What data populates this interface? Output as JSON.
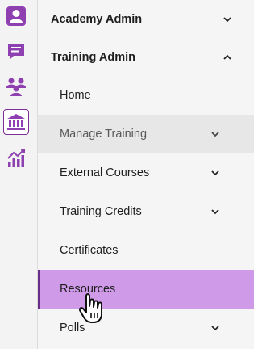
{
  "rail": {
    "icons": [
      "person-icon",
      "chat-icon",
      "group-icon",
      "academy-icon",
      "analytics-icon"
    ],
    "active_icon": "academy-icon",
    "accent_color": "#7a2f9a"
  },
  "menu": {
    "sections": [
      {
        "label": "Academy Admin",
        "expanded": false
      },
      {
        "label": "Training Admin",
        "expanded": true
      }
    ],
    "items": [
      {
        "label": "Home",
        "has_children": false
      },
      {
        "label": "Manage Training",
        "has_children": true,
        "state": "hover"
      },
      {
        "label": "External Courses",
        "has_children": true
      },
      {
        "label": "Training Credits",
        "has_children": true
      },
      {
        "label": "Certificates",
        "has_children": false
      },
      {
        "label": "Resources",
        "has_children": false,
        "state": "selected"
      },
      {
        "label": "Polls",
        "has_children": true
      }
    ],
    "selected_color": "#cf9ae8",
    "hover_color": "#e7e7e7"
  }
}
